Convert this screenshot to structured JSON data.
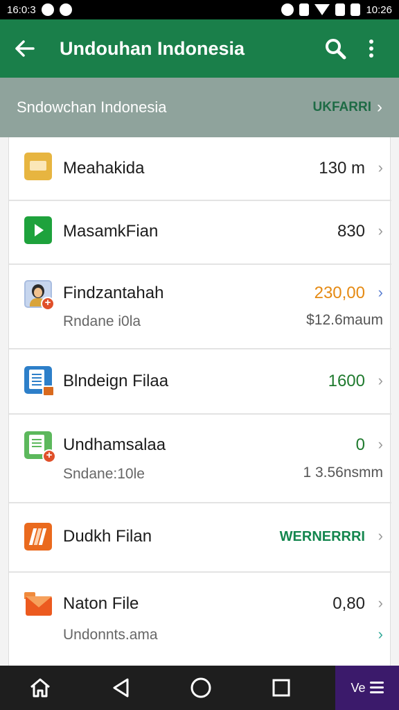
{
  "status_bar": {
    "time_left": "16:0:3",
    "time_right": "10:26"
  },
  "app_bar": {
    "title": "Undouhan Indonesia"
  },
  "sub_header": {
    "title": "Sndowchan Indonesia",
    "action_label": "UKFARRI"
  },
  "items": [
    {
      "name": "Meahakida",
      "value": "130 m",
      "icon": "folder-icon"
    },
    {
      "name": "MasamkFian",
      "value": "830",
      "icon": "play-icon"
    },
    {
      "name": "Findzantahah",
      "value": "230,00",
      "sub": "Rndane i0la",
      "sub_value": "$12.6maum",
      "icon": "person-icon"
    },
    {
      "name": "Blndeign Filaa",
      "value": "1600",
      "icon": "document-icon"
    },
    {
      "name": "Undhamsalaa",
      "value": "0",
      "sub": "Sndane:10le",
      "sub_value": "1 3.56nsmm",
      "icon": "spreadsheet-icon"
    },
    {
      "name": "Dudkh Filan",
      "value": "WERNERRRI",
      "icon": "books-icon"
    },
    {
      "name": "Naton File",
      "value": "0,80",
      "sub": "Undonnts.ama",
      "icon": "mail-icon"
    }
  ],
  "nav_bar": {
    "extra_label": "Ve"
  },
  "colors": {
    "app_bar": "#1a7f4a",
    "sub_header": "#8fa39c",
    "accent_orange": "#e58a13",
    "accent_green": "#13864e",
    "nav_extra": "#3b1a6b"
  }
}
